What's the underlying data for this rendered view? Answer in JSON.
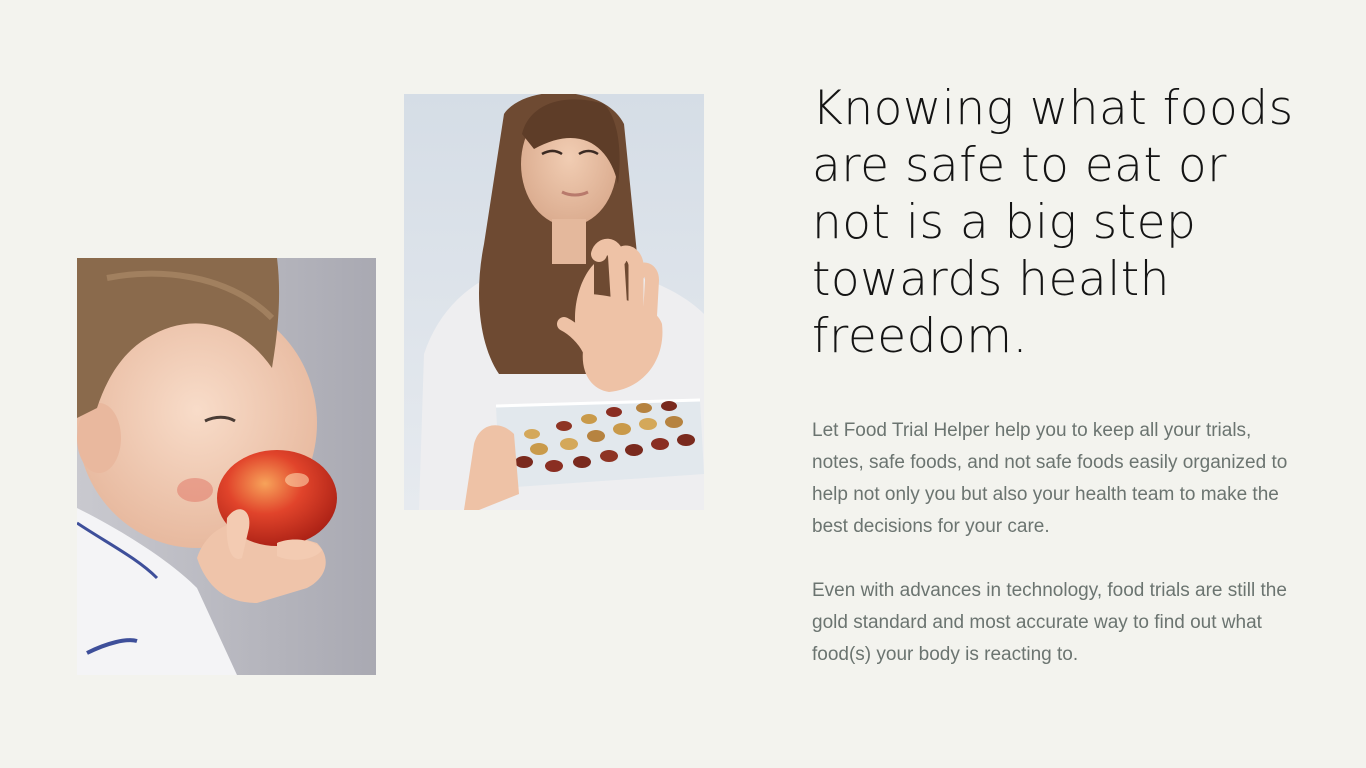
{
  "colors": {
    "page_background": "#f3f3ee",
    "headline_text": "#141414",
    "body_text": "#6b7470"
  },
  "images": {
    "child_photo": {
      "icon": "child-eating-apple-photo"
    },
    "woman_photo": {
      "icon": "woman-refusing-nuts-photo"
    }
  },
  "headline": "Knowing what foods are safe to eat or not is a big step towards health freedom.",
  "paragraphs": {
    "intro": "Let Food Trial Helper help you to keep all your trials, notes, safe foods, and not safe foods easily organized to help not only you but also your health team to make the best decisions for your care.",
    "technology": "Even with advances in technology, food trials are still the gold standard and most accurate way to find out what food(s) your body is reacting to."
  }
}
